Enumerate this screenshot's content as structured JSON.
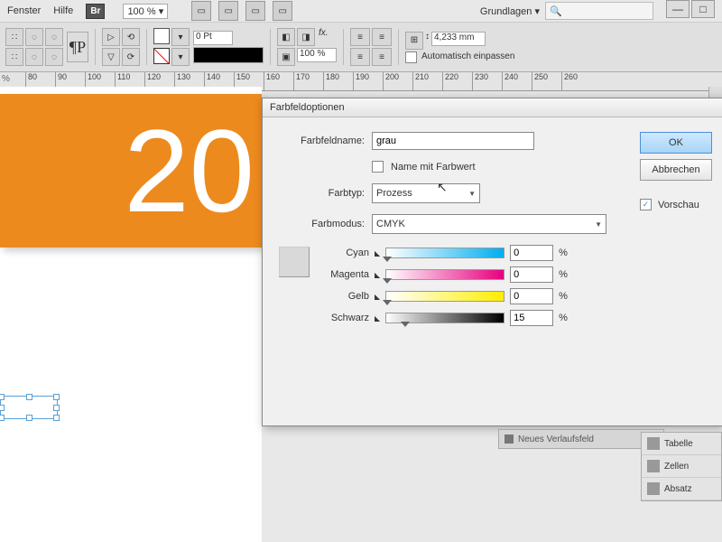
{
  "menu": {
    "fenster": "Fenster",
    "hilfe": "Hilfe",
    "br": "Br",
    "zoom": "100 %"
  },
  "workspace": "Grundlagen",
  "ruler": {
    "unit": "%",
    "marks": [
      "80",
      "90",
      "100",
      "110",
      "120",
      "130",
      "140",
      "150",
      "160",
      "170",
      "180",
      "190",
      "200",
      "210",
      "220",
      "230",
      "240",
      "250",
      "260"
    ]
  },
  "canvas": {
    "bigtext": "20"
  },
  "toolbar": {
    "pt": "0 Pt",
    "opacity": "100 %",
    "width": "4,233 mm",
    "autofit": "Automatisch einpassen"
  },
  "dialog": {
    "title": "Farbfeldoptionen",
    "name_label": "Farbfeldname:",
    "name_value": "grau",
    "name_with_value": "Name mit Farbwert",
    "type_label": "Farbtyp:",
    "type_value": "Prozess",
    "mode_label": "Farbmodus:",
    "mode_value": "CMYK",
    "ok": "OK",
    "cancel": "Abbrechen",
    "preview": "Vorschau",
    "sliders": {
      "cyan": {
        "label": "Cyan",
        "value": "0"
      },
      "magenta": {
        "label": "Magenta",
        "value": "0"
      },
      "yellow": {
        "label": "Gelb",
        "value": "0"
      },
      "black": {
        "label": "Schwarz",
        "value": "15"
      }
    },
    "pct": "%"
  },
  "bottom_tab": "Neues Verlaufsfeld",
  "panels": {
    "p1": "Tabelle",
    "p2": "Zellen",
    "p3": "Absatz"
  }
}
